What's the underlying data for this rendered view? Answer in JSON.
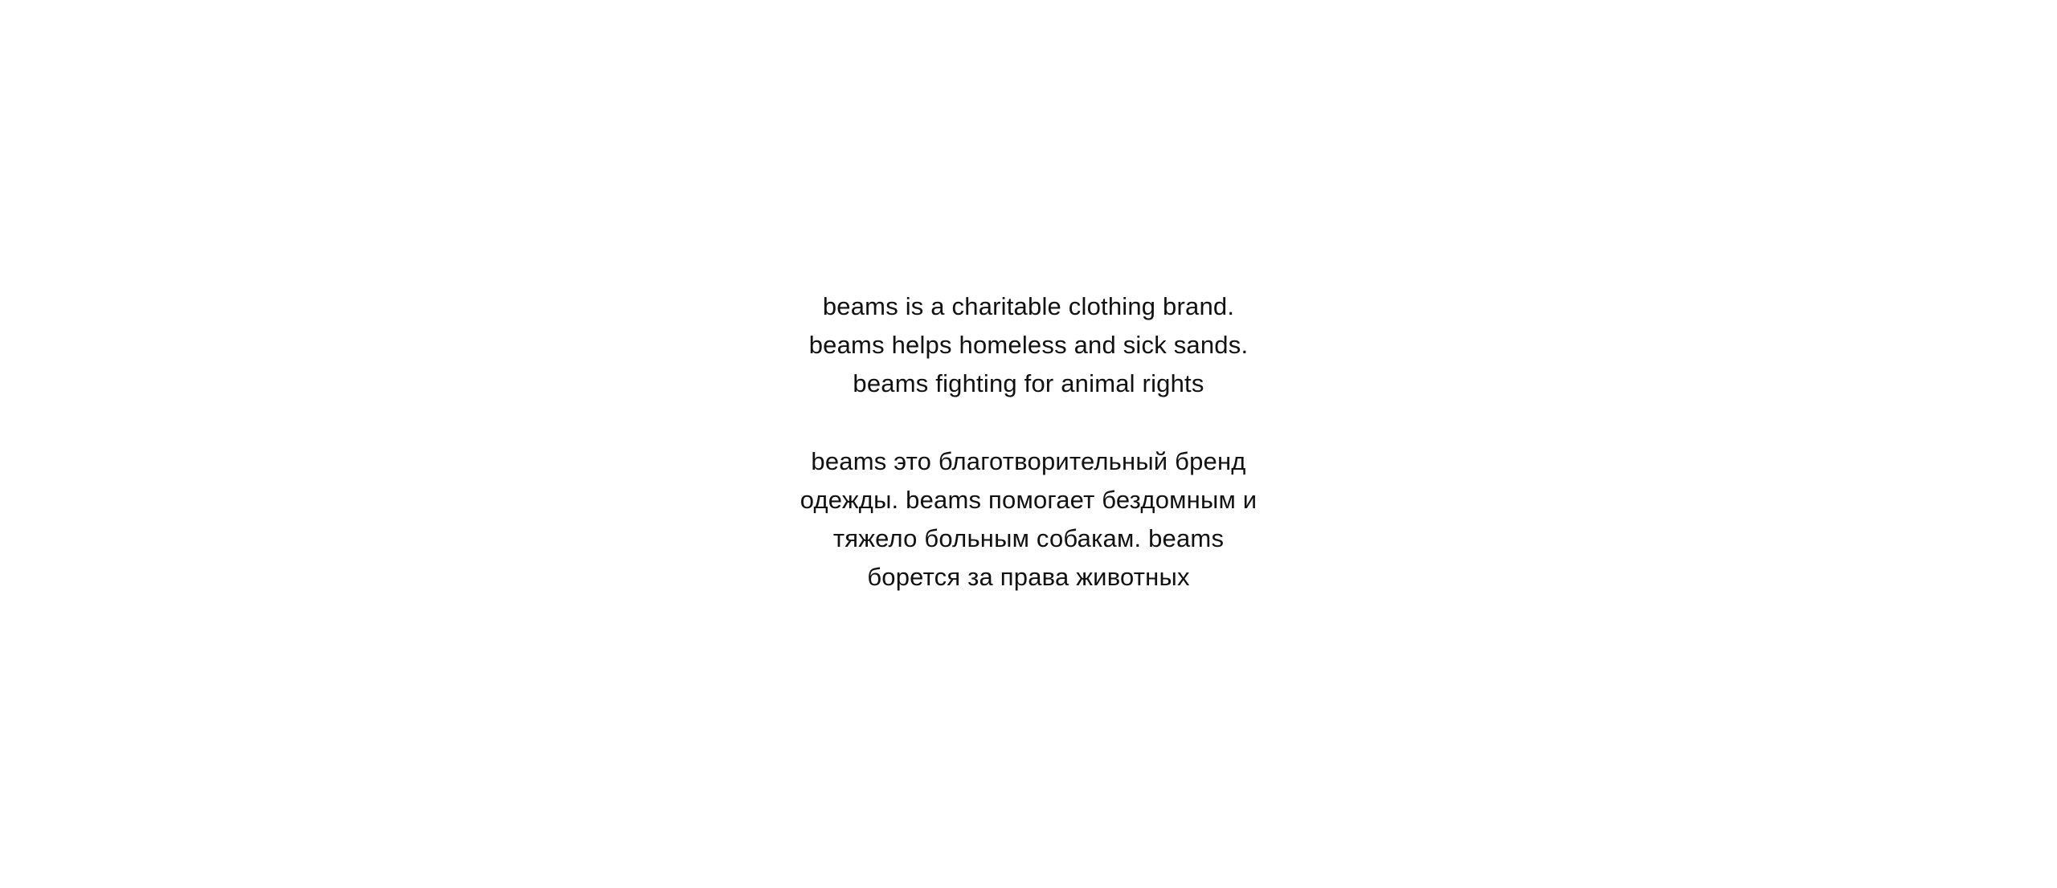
{
  "about": {
    "en": [
      "beams is a charitable clothing brand.",
      "beams helps homeless and sick sands.",
      "beams fighting for animal rights"
    ],
    "ru": [
      "beams это благотворительный бренд",
      "одежды. beams помогает бездомным и",
      "тяжело больным собакам. beams",
      "борется за права животных"
    ]
  },
  "colors": {
    "background": "#ffffff",
    "text": "#111111"
  }
}
